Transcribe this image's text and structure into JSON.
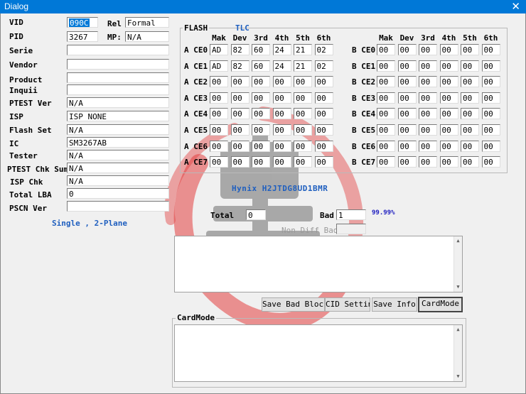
{
  "window": {
    "title": "Dialog",
    "close_glyph": "✕"
  },
  "left": {
    "vid_label": "VID",
    "vid_value": "090C",
    "rel_label": "Rel",
    "rel_value": "Formal",
    "pid_label": "PID",
    "pid_value": "3267",
    "mp_label": "MP:",
    "mp_value": "N/A",
    "serie_label": "Serie",
    "serie_value": "",
    "vendor_label": "Vendor",
    "vendor_value": "",
    "product_label_1": "Product",
    "product_label_2": "Inquii",
    "product_value": "",
    "ptest_ver_label": "PTEST Ver",
    "ptest_ver_value": "N/A",
    "isp_label": "ISP",
    "isp_value": "ISP NONE",
    "flash_set_label": "Flash Set",
    "flash_set_value": "N/A",
    "ic_label": "IC",
    "ic_value": "SM3267AB",
    "tester_label": "Tester",
    "tester_value": "N/A",
    "ptest_chk_label": "PTEST Chk Sum",
    "ptest_chk_value": "N/A",
    "isp_chk_label": "ISP Chk",
    "isp_chk_value": "N/A",
    "total_lba_label": "Total LBA",
    "total_lba_value": "0",
    "pscn_ver_label": "PSCN Ver",
    "pscn_ver_value": "",
    "plane_info": "Single , 2-Plane"
  },
  "flash": {
    "group_title": "FLASH",
    "type": "TLC",
    "columns": [
      "Mak",
      "Dev",
      "3rd",
      "4th",
      "5th",
      "6th"
    ],
    "a_rows": [
      {
        "label": "A CE0",
        "cells": [
          "AD",
          "82",
          "60",
          "24",
          "21",
          "02"
        ]
      },
      {
        "label": "A CE1",
        "cells": [
          "AD",
          "82",
          "60",
          "24",
          "21",
          "02"
        ]
      },
      {
        "label": "A CE2",
        "cells": [
          "00",
          "00",
          "00",
          "00",
          "00",
          "00"
        ]
      },
      {
        "label": "A CE3",
        "cells": [
          "00",
          "00",
          "00",
          "00",
          "00",
          "00"
        ]
      },
      {
        "label": "A CE4",
        "cells": [
          "00",
          "00",
          "00",
          "00",
          "00",
          "00"
        ]
      },
      {
        "label": "A CE5",
        "cells": [
          "00",
          "00",
          "00",
          "00",
          "00",
          "00"
        ]
      },
      {
        "label": "A CE6",
        "cells": [
          "00",
          "00",
          "00",
          "00",
          "00",
          "00"
        ]
      },
      {
        "label": "A CE7",
        "cells": [
          "00",
          "00",
          "00",
          "00",
          "00",
          "00"
        ]
      }
    ],
    "b_rows": [
      {
        "label": "B CE0",
        "cells": [
          "00",
          "00",
          "00",
          "00",
          "00",
          "00"
        ]
      },
      {
        "label": "B CE1",
        "cells": [
          "00",
          "00",
          "00",
          "00",
          "00",
          "00"
        ]
      },
      {
        "label": "B CE2",
        "cells": [
          "00",
          "00",
          "00",
          "00",
          "00",
          "00"
        ]
      },
      {
        "label": "B CE3",
        "cells": [
          "00",
          "00",
          "00",
          "00",
          "00",
          "00"
        ]
      },
      {
        "label": "B CE4",
        "cells": [
          "00",
          "00",
          "00",
          "00",
          "00",
          "00"
        ]
      },
      {
        "label": "B CE5",
        "cells": [
          "00",
          "00",
          "00",
          "00",
          "00",
          "00"
        ]
      },
      {
        "label": "B CE6",
        "cells": [
          "00",
          "00",
          "00",
          "00",
          "00",
          "00"
        ]
      },
      {
        "label": "B CE7",
        "cells": [
          "00",
          "00",
          "00",
          "00",
          "00",
          "00"
        ]
      }
    ],
    "part_number": "Hynix H2JTDG8UD1BMR"
  },
  "stats": {
    "total_label": "Total",
    "total_value": "0",
    "bad_label": "Bad",
    "bad_value": "1",
    "percent": "99.99%",
    "non_diff_label": "Non Diff Bad",
    "non_diff_value": ""
  },
  "buttons": {
    "save_bad_block": "Save Bad Block",
    "cid_setting": "CID Setting",
    "save_info": "Save Info",
    "card_mode": "CardMode"
  },
  "cardmode_group": {
    "title": "CardMode"
  },
  "colors": {
    "title_bar": "#0078d7",
    "selection": "#0078d7",
    "accent_text": "#1f5fbf",
    "watermark": "#e03030"
  }
}
